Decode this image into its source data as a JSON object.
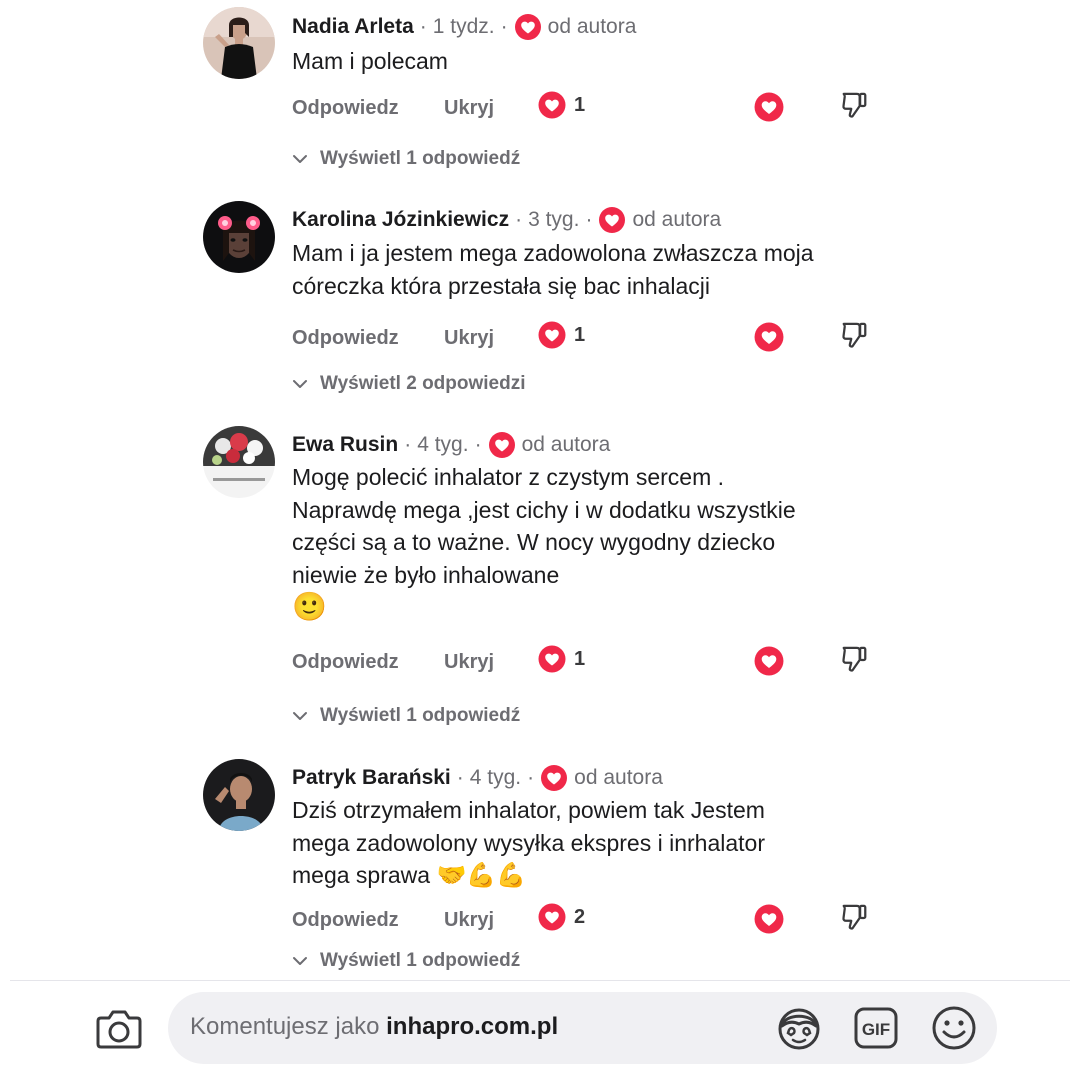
{
  "labels": {
    "reply": "Odpowiedz",
    "hide": "Ukryj",
    "from_author": "od autora",
    "separator": "·"
  },
  "colors": {
    "heart": "#f02849",
    "meta": "#6d6d72",
    "text": "#1c1c1e"
  },
  "comments": [
    {
      "name": "Nadia Arleta",
      "time": "1 tydz.",
      "text": "Mam i polecam",
      "emoji": "",
      "likes": "1",
      "replies": "Wyświetl 1 odpowiedź",
      "avatar_icon": "woman-black-dress-avatar"
    },
    {
      "name": "Karolina Józinkiewicz",
      "time": "3 tyg.",
      "text": "Mam i ja jestem mega zadowolona zwłaszcza moja córeczka która przestała się bac inhalacji",
      "emoji": "",
      "likes": "1",
      "replies": "Wyświetl 2 odpowiedzi",
      "avatar_icon": "girl-with-flower-ears-avatar"
    },
    {
      "name": "Ewa Rusin",
      "time": "4 tyg.",
      "text": "Mogę polecić inhalator z czystym sercem . Naprawdę mega ,jest cichy i w dodatku wszystkie części są a to ważne. W nocy wygodny dziecko niewie że było inhalowane",
      "emoji": "🙂",
      "likes": "1",
      "replies": "Wyświetl 1 odpowiedź",
      "avatar_icon": "flowers-bouquet-avatar"
    },
    {
      "name": "Patryk Barański",
      "time": "4 tyg.",
      "text": "Dziś otrzymałem inhalator, powiem tak Jestem mega zadowolony wysyłka ekspres i inrhalator mega sprawa",
      "emoji": "🤝💪💪",
      "likes": "2",
      "replies": "Wyświetl 1 odpowiedź",
      "avatar_icon": "man-portrait-avatar"
    }
  ],
  "composer": {
    "prefix": "Komentujesz jako",
    "page_name": "inhapro.com.pl",
    "icons": [
      "camera-icon",
      "avatar-sticker-icon",
      "gif-icon",
      "emoji-icon"
    ]
  }
}
